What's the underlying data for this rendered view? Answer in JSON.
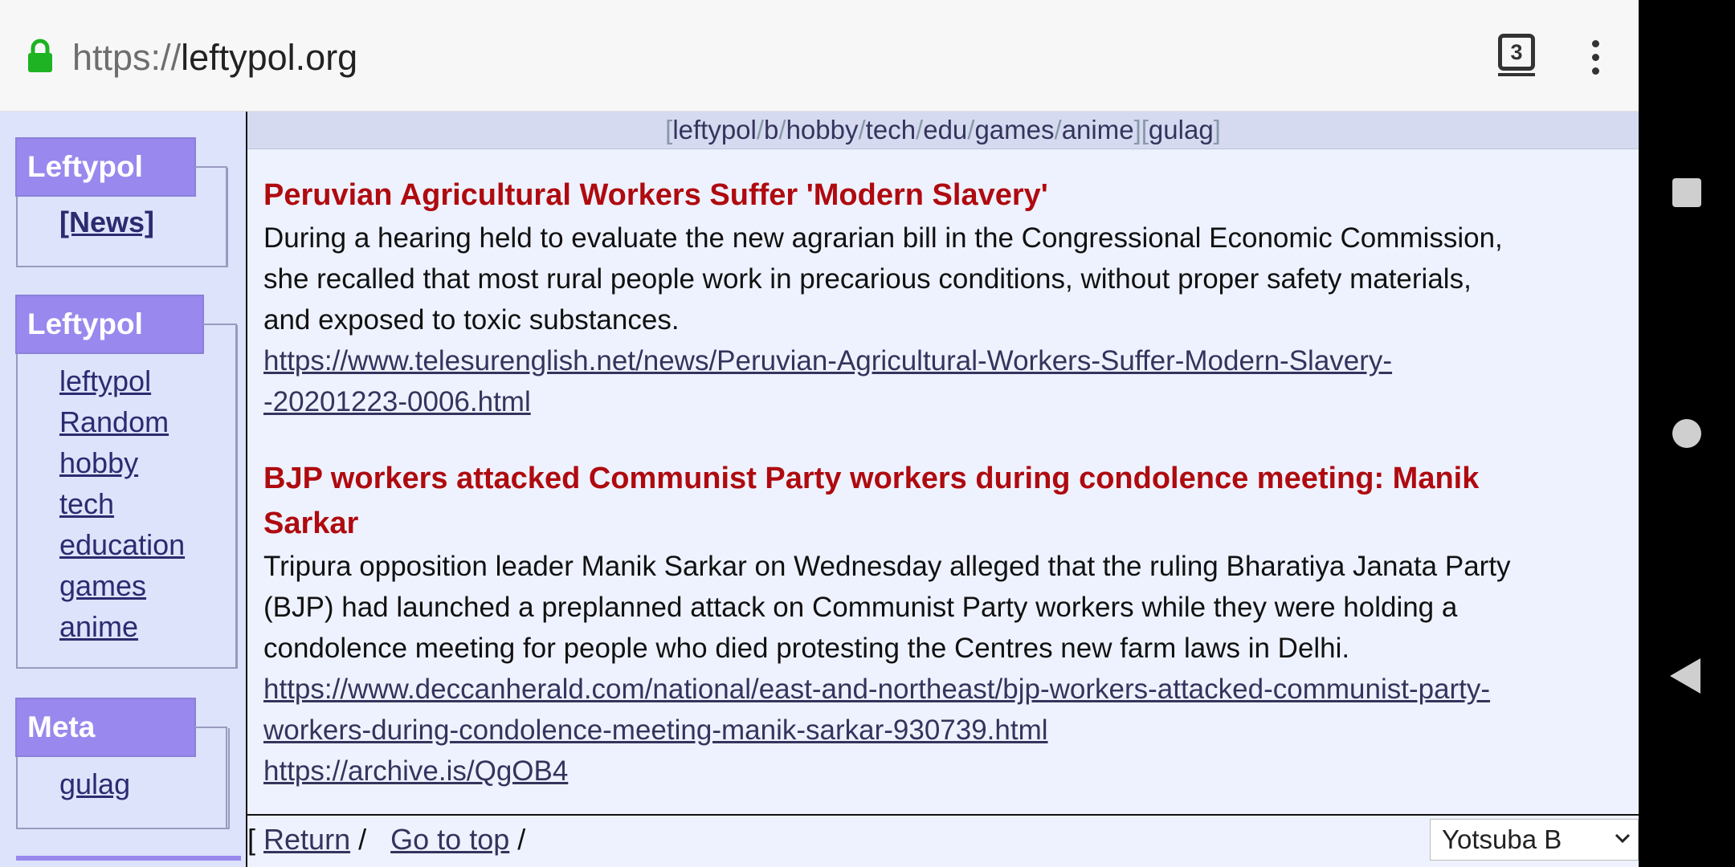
{
  "browser": {
    "url_scheme": "https://",
    "url_host": "leftypol.org",
    "tab_count": "3"
  },
  "sidebar": {
    "boxes": [
      {
        "title": "Leftypol",
        "items": [
          "[News]"
        ]
      },
      {
        "title": "Leftypol",
        "items": [
          "leftypol",
          "Random",
          "hobby",
          "tech",
          "education",
          "games",
          "anime"
        ]
      },
      {
        "title": "Meta",
        "items": [
          "gulag"
        ]
      }
    ]
  },
  "boardlist": {
    "items": [
      "leftypol",
      "b",
      "hobby",
      "tech",
      "edu",
      "games",
      "anime"
    ],
    "extra": "gulag"
  },
  "posts": [
    {
      "title": "Peruvian Agricultural Workers Suffer 'Modern Slavery'",
      "body": "During a hearing held to evaluate the new agrarian bill in the Congressional Economic Commission, she recalled that most rural people work in precarious conditions, without proper safety materials, and exposed to toxic substances.",
      "link": "https://www.telesurenglish.net/news/Peruvian-Agricultural-Workers-Suffer-Modern-Slavery--20201223-0006.html"
    },
    {
      "title": "BJP workers attacked Communist Party workers during condolence meeting: Manik Sarkar",
      "body": "Tripura opposition leader Manik Sarkar on Wednesday alleged that the ruling Bharatiya Janata Party (BJP) had launched a preplanned attack on Communist Party workers while they were holding a condolence meeting for people who died protesting the Centres new farm laws in Delhi.",
      "link": "https://www.deccanherald.com/national/east-and-northeast/bjp-workers-attacked-communist-party-workers-during-condolence-meeting-manik-sarkar-930739.html",
      "link2": "https://archive.is/QgOB4"
    }
  ],
  "bottombar": {
    "bracket": "[",
    "return_label": "Return",
    "slash": "/",
    "top_label": "Go to top",
    "style_value": "Yotsuba B"
  },
  "colors": {
    "header_bg": "#9988ee",
    "title_red": "#af0a0f",
    "link": "#34345c",
    "page_bg": "#eef2ff"
  }
}
